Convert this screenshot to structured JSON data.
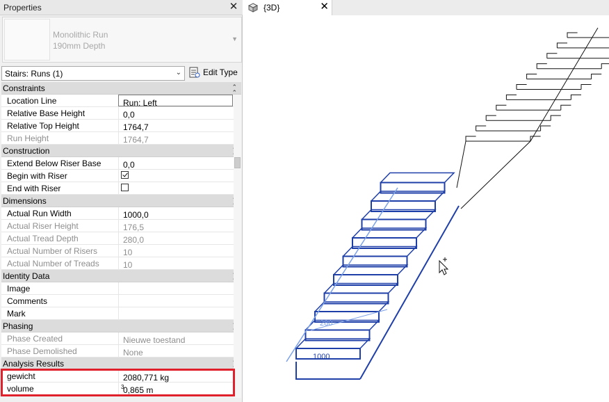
{
  "properties": {
    "title": "Properties",
    "type_name_line1": "Monolithic Run",
    "type_name_line2": "190mm Depth",
    "filter_value": "Stairs: Runs (1)",
    "edit_type_label": "Edit Type",
    "groups": [
      {
        "name": "Constraints",
        "rows": [
          {
            "label": "Location Line",
            "value": "Run: Left",
            "readonly": false,
            "editing": true
          },
          {
            "label": "Relative Base Height",
            "value": "0,0",
            "readonly": false
          },
          {
            "label": "Relative Top Height",
            "value": "1764,7",
            "readonly": false
          },
          {
            "label": "Run Height",
            "value": "1764,7",
            "readonly": true
          }
        ]
      },
      {
        "name": "Construction",
        "rows": [
          {
            "label": "Extend Below Riser Base",
            "value": "0,0",
            "readonly": false
          },
          {
            "label": "Begin with Riser",
            "checkbox": true,
            "checked": true
          },
          {
            "label": "End with Riser",
            "checkbox": true,
            "checked": false
          }
        ]
      },
      {
        "name": "Dimensions",
        "rows": [
          {
            "label": "Actual Run Width",
            "value": "1000,0",
            "readonly": false
          },
          {
            "label": "Actual Riser Height",
            "value": "176,5",
            "readonly": true
          },
          {
            "label": "Actual Tread Depth",
            "value": "280,0",
            "readonly": true
          },
          {
            "label": "Actual Number of Risers",
            "value": "10",
            "readonly": true
          },
          {
            "label": "Actual Number of Treads",
            "value": "10",
            "readonly": true
          }
        ]
      },
      {
        "name": "Identity Data",
        "rows": [
          {
            "label": "Image",
            "value": "",
            "readonly": false
          },
          {
            "label": "Comments",
            "value": "",
            "readonly": false
          },
          {
            "label": "Mark",
            "value": "",
            "readonly": false
          }
        ]
      },
      {
        "name": "Phasing",
        "rows": [
          {
            "label": "Phase Created",
            "value": "Nieuwe toestand",
            "readonly": true
          },
          {
            "label": "Phase Demolished",
            "value": "None",
            "readonly": true
          }
        ]
      },
      {
        "name": "Analysis Results",
        "rows": [
          {
            "label": "gewicht",
            "value": "2080,771 kg",
            "readonly": false
          },
          {
            "label": "volume",
            "value": "0,865 m",
            "unit_sup": "3",
            "readonly": false
          }
        ]
      }
    ]
  },
  "view": {
    "tab_label": "{3D}",
    "dimension_labels": [
      "1000",
      "280"
    ]
  },
  "colors": {
    "selection": "#1f3fa8",
    "highlight": "#e0202a"
  }
}
